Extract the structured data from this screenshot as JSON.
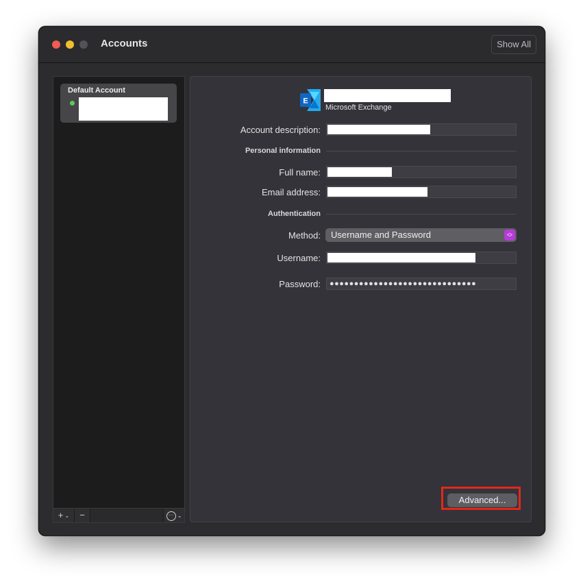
{
  "window": {
    "title": "Accounts",
    "show_all_label": "Show All"
  },
  "sidebar": {
    "account": {
      "title": "Default Account",
      "status_color": "#5fc85b"
    },
    "toolbar": {
      "add_label": "+",
      "remove_label": "−",
      "add_icon": "plus-icon",
      "more_icon": "ellipsis-circle-icon"
    }
  },
  "account_detail": {
    "account_type": "Microsoft Exchange",
    "icon": "microsoft-exchange-icon",
    "fields": {
      "account_description_label": "Account description:",
      "full_name_label": "Full name:",
      "email_address_label": "Email address:",
      "method_label": "Method:",
      "username_label": "Username:",
      "password_label": "Password:"
    },
    "sections": {
      "personal_information": "Personal information",
      "authentication": "Authentication"
    },
    "method_value": "Username and Password",
    "password_value": "●●●●●●●●●●●●●●●●●●●●●●●●●●●●●●",
    "advanced_label": "Advanced..."
  },
  "colors": {
    "accent_select": "#b73bd8",
    "highlight_box": "#e3271a",
    "status_online": "#5fc85b"
  }
}
